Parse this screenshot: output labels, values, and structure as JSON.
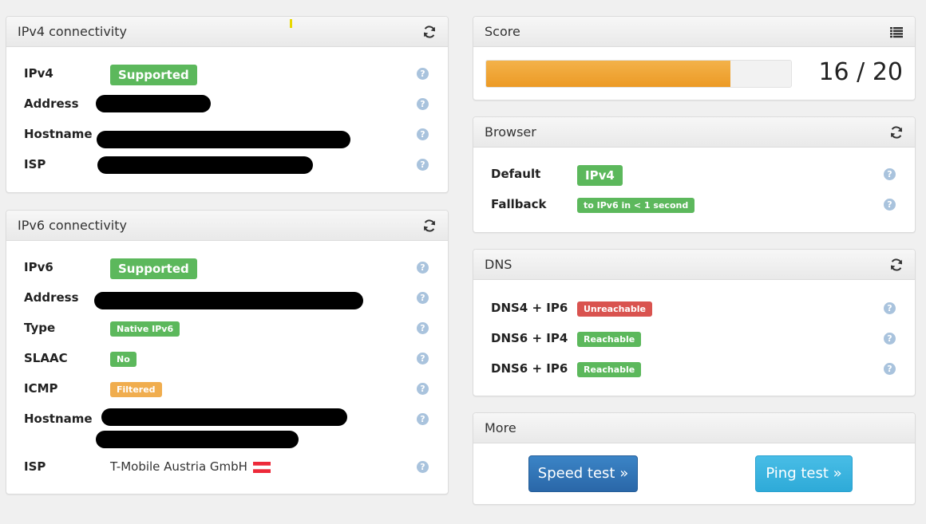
{
  "ipv4": {
    "title": "IPv4 connectivity",
    "rows": {
      "ipv4": {
        "label": "IPv4",
        "badge": "Supported"
      },
      "address": {
        "label": "Address"
      },
      "hostname": {
        "label": "Hostname"
      },
      "isp": {
        "label": "ISP"
      }
    }
  },
  "ipv6": {
    "title": "IPv6 connectivity",
    "rows": {
      "ipv6": {
        "label": "IPv6",
        "badge": "Supported"
      },
      "address": {
        "label": "Address"
      },
      "type": {
        "label": "Type",
        "badge": "Native IPv6"
      },
      "slaac": {
        "label": "SLAAC",
        "badge": "No"
      },
      "icmp": {
        "label": "ICMP",
        "badge": "Filtered"
      },
      "hostname": {
        "label": "Hostname"
      },
      "isp": {
        "label": "ISP",
        "value": "T-Mobile Austria GmbH"
      }
    }
  },
  "score": {
    "title": "Score",
    "value": 16,
    "max": 20,
    "text": "16 / 20",
    "bar_color": "#f0a030"
  },
  "browser": {
    "title": "Browser",
    "rows": {
      "default": {
        "label": "Default",
        "badge": "IPv4"
      },
      "fallback": {
        "label": "Fallback",
        "badge": "to IPv6 in < 1 second"
      }
    }
  },
  "dns": {
    "title": "DNS",
    "rows": {
      "dns4_ip6": {
        "label": "DNS4 + IP6",
        "badge": "Unreachable"
      },
      "dns6_ip4": {
        "label": "DNS6 + IP4",
        "badge": "Reachable"
      },
      "dns6_ip6": {
        "label": "DNS6 + IP6",
        "badge": "Reachable"
      }
    }
  },
  "more": {
    "title": "More",
    "speed_test": "Speed test »",
    "ping_test": "Ping test »"
  },
  "help_glyph": "?",
  "icons": {
    "refresh": "refresh-icon",
    "list": "list-icon",
    "help": "help-icon",
    "flag": "austria-flag-icon"
  },
  "colors": {
    "success": "#5cb85c",
    "danger": "#d9534f",
    "warning": "#f0ad4e",
    "primary": "#337ab7",
    "info": "#3bb4df"
  }
}
